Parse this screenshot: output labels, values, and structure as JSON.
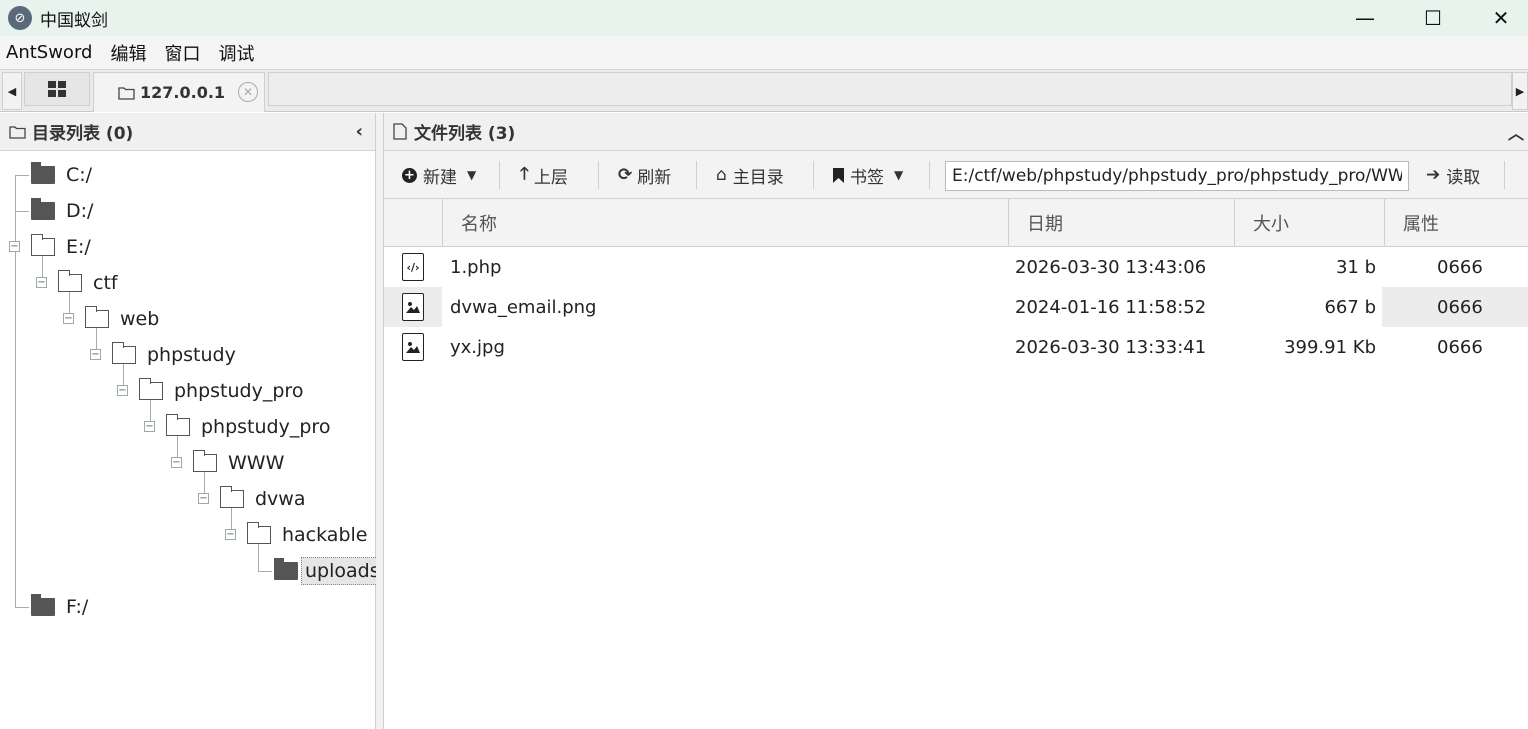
{
  "window": {
    "title": "中国蚁剑"
  },
  "menu": [
    "AntSword",
    "编辑",
    "窗口",
    "调试"
  ],
  "tabs": {
    "active_label": "127.0.0.1"
  },
  "dir_panel": {
    "title": "目录列表 (0)",
    "tree": [
      {
        "label": "C:/"
      },
      {
        "label": "D:/"
      },
      {
        "label": "E:/"
      },
      {
        "label": "ctf"
      },
      {
        "label": "web"
      },
      {
        "label": "phpstudy"
      },
      {
        "label": "phpstudy_pro"
      },
      {
        "label": "phpstudy_pro"
      },
      {
        "label": "WWW"
      },
      {
        "label": "dvwa"
      },
      {
        "label": "hackable"
      },
      {
        "label": "uploads"
      },
      {
        "label": "F:/"
      }
    ]
  },
  "file_panel": {
    "title": "文件列表 (3)",
    "toolbar": {
      "new_label": "新建",
      "up_label": "上层",
      "refresh_label": "刷新",
      "home_label": "主目录",
      "bookmark_label": "书签",
      "path_value": "E:/ctf/web/phpstudy/phpstudy_pro/phpstudy_pro/WWW",
      "read_label": "读取"
    },
    "columns": [
      "名称",
      "日期",
      "大小",
      "属性"
    ],
    "rows": [
      {
        "name": "1.php",
        "date": "2026-03-30 13:43:06",
        "size": "31 b",
        "perm": "0666",
        "icon": "php-file-icon"
      },
      {
        "name": "dvwa_email.png",
        "date": "2024-01-16 11:58:52",
        "size": "667 b",
        "perm": "0666",
        "icon": "image-file-icon"
      },
      {
        "name": "yx.jpg",
        "date": "2026-03-30 13:33:41",
        "size": "399.91 Kb",
        "perm": "0666",
        "icon": "image-file-icon"
      }
    ]
  }
}
